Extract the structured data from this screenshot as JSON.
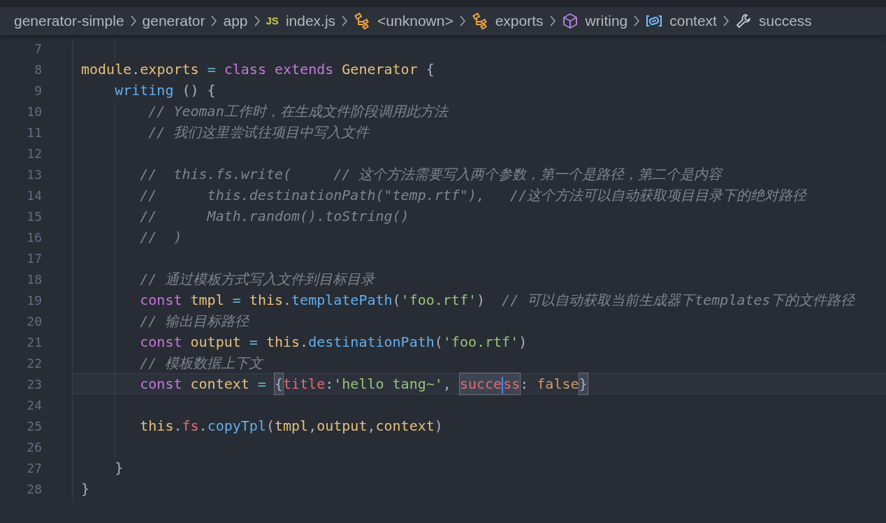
{
  "breadcrumbs": [
    {
      "label": "generator-simple"
    },
    {
      "label": "generator"
    },
    {
      "label": "app"
    },
    {
      "label": "index.js",
      "kind": "file",
      "badge": "JS"
    },
    {
      "label": "<unknown>",
      "kind": "namespace"
    },
    {
      "label": "exports",
      "kind": "namespace"
    },
    {
      "label": "writing",
      "kind": "method"
    },
    {
      "label": "context",
      "kind": "variable"
    },
    {
      "label": "success",
      "kind": "field"
    }
  ],
  "lines": [
    {
      "number": "7",
      "current": false
    },
    {
      "number": "8",
      "current": false,
      "tokens": [
        {
          "kind": "variable",
          "text": "module"
        },
        {
          "kind": "punct",
          "text": "."
        },
        {
          "kind": "variable",
          "text": "exports"
        },
        {
          "kind": "operator",
          "text": " = "
        },
        {
          "kind": "keyword",
          "text": "class"
        },
        {
          "kind": "keyword",
          "text": " extends"
        },
        {
          "kind": "variable",
          "text": " Generator"
        },
        {
          "kind": "punct",
          "text": " {"
        }
      ]
    },
    {
      "number": "9",
      "current": false,
      "tokens": [
        {
          "kind": "function",
          "text": "    writing"
        },
        {
          "kind": "punct",
          "text": " () {"
        }
      ]
    },
    {
      "number": "10",
      "current": false,
      "tokens": [
        {
          "kind": "comment",
          "text": "        // Yeoman工作时，在生成文件阶段调用此方法"
        }
      ]
    },
    {
      "number": "11",
      "current": false,
      "tokens": [
        {
          "kind": "comment",
          "text": "        // 我们这里尝试往项目中写入文件"
        }
      ]
    },
    {
      "number": "12",
      "current": false
    },
    {
      "number": "13",
      "current": false,
      "tokens": [
        {
          "kind": "comment",
          "text": "       //  this.fs.write(     // 这个方法需要写入两个参数，第一个是路径，第二个是内容"
        }
      ]
    },
    {
      "number": "14",
      "current": false,
      "tokens": [
        {
          "kind": "comment",
          "text": "       //      this.destinationPath(\"temp.rtf\"),   //这个方法可以自动获取项目目录下的绝对路径"
        }
      ]
    },
    {
      "number": "15",
      "current": false,
      "tokens": [
        {
          "kind": "comment",
          "text": "       //      Math.random().toString()"
        }
      ]
    },
    {
      "number": "16",
      "current": false,
      "tokens": [
        {
          "kind": "comment",
          "text": "       //  )"
        }
      ]
    },
    {
      "number": "17",
      "current": false
    },
    {
      "number": "18",
      "current": false,
      "tokens": [
        {
          "kind": "comment",
          "text": "       // 通过模板方式写入文件到目标目录"
        }
      ]
    },
    {
      "number": "19",
      "current": false,
      "tokens": [
        {
          "kind": "keyword",
          "text": "       const"
        },
        {
          "kind": "variable",
          "text": " tmpl"
        },
        {
          "kind": "operator",
          "text": " = "
        },
        {
          "kind": "variable",
          "text": "this"
        },
        {
          "kind": "punct",
          "text": "."
        },
        {
          "kind": "function",
          "text": "templatePath"
        },
        {
          "kind": "punct",
          "text": "("
        },
        {
          "kind": "string",
          "text": "'foo.rtf'"
        },
        {
          "kind": "punct",
          "text": ")"
        },
        {
          "kind": "comment",
          "text": "  // 可以自动获取当前生成器下templates下的文件路径"
        }
      ]
    },
    {
      "number": "20",
      "current": false,
      "tokens": [
        {
          "kind": "comment",
          "text": "       // 输出目标路径"
        }
      ]
    },
    {
      "number": "21",
      "current": false,
      "tokens": [
        {
          "kind": "keyword",
          "text": "       const"
        },
        {
          "kind": "variable",
          "text": " output"
        },
        {
          "kind": "operator",
          "text": " = "
        },
        {
          "kind": "variable",
          "text": "this"
        },
        {
          "kind": "punct",
          "text": "."
        },
        {
          "kind": "function",
          "text": "destinationPath"
        },
        {
          "kind": "punct",
          "text": "("
        },
        {
          "kind": "string",
          "text": "'foo.rtf'"
        },
        {
          "kind": "punct",
          "text": ")"
        }
      ]
    },
    {
      "number": "22",
      "current": false,
      "tokens": [
        {
          "kind": "comment",
          "text": "       // 模板数据上下文"
        }
      ]
    },
    {
      "number": "23",
      "current": true,
      "tokens": [
        {
          "kind": "keyword",
          "text": "       const"
        },
        {
          "kind": "variable",
          "text": " context"
        },
        {
          "kind": "operator",
          "text": " = "
        },
        {
          "kind": "punct",
          "text": "{",
          "highlighted": true
        },
        {
          "kind": "property",
          "text": "title"
        },
        {
          "kind": "punct",
          "text": ":"
        },
        {
          "kind": "string",
          "text": "'hello tang~'"
        },
        {
          "kind": "punct",
          "text": ", "
        },
        {
          "kind": "property",
          "text": "succe",
          "after_cursor": "ss",
          "highlighted": true
        },
        {
          "kind": "punct",
          "text": ": "
        },
        {
          "kind": "constant",
          "text": "false"
        },
        {
          "kind": "punct",
          "text": "}",
          "highlighted": true
        }
      ]
    },
    {
      "number": "24",
      "current": false
    },
    {
      "number": "25",
      "current": false,
      "tokens": [
        {
          "kind": "variable",
          "text": "       this"
        },
        {
          "kind": "punct",
          "text": "."
        },
        {
          "kind": "property",
          "text": "fs"
        },
        {
          "kind": "punct",
          "text": "."
        },
        {
          "kind": "function",
          "text": "copyTpl"
        },
        {
          "kind": "punct",
          "text": "("
        },
        {
          "kind": "variable",
          "text": "tmpl"
        },
        {
          "kind": "punct",
          "text": ","
        },
        {
          "kind": "variable",
          "text": "output"
        },
        {
          "kind": "punct",
          "text": ","
        },
        {
          "kind": "variable",
          "text": "context"
        },
        {
          "kind": "punct",
          "text": ")"
        }
      ]
    },
    {
      "number": "26",
      "current": false
    },
    {
      "number": "27",
      "current": false,
      "tokens": [
        {
          "kind": "punct",
          "text": "    }"
        }
      ]
    },
    {
      "number": "28",
      "current": false,
      "tokens": [
        {
          "kind": "punct",
          "text": "}"
        }
      ]
    }
  ]
}
